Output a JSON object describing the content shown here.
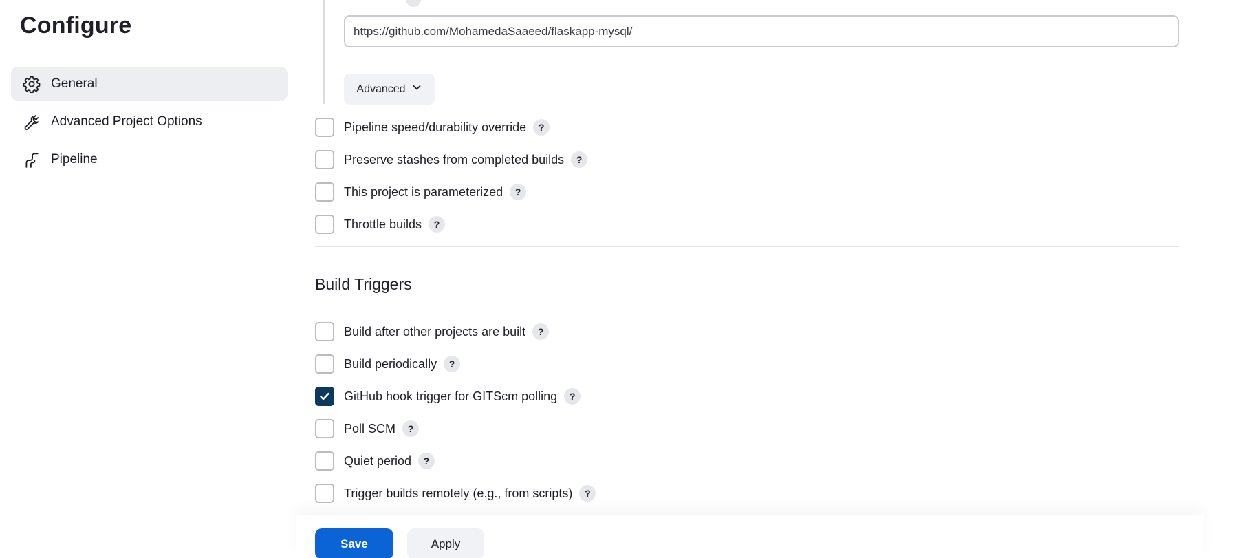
{
  "sidebar": {
    "title": "Configure",
    "items": [
      {
        "label": "General",
        "icon": "gear-icon",
        "active": true
      },
      {
        "label": "Advanced Project Options",
        "icon": "wrench-icon",
        "active": false
      },
      {
        "label": "Pipeline",
        "icon": "pipeline-icon",
        "active": false
      }
    ]
  },
  "scm": {
    "url_value": "https://github.com/MohamedaSaaeed/flaskapp-mysql/",
    "advanced_label": "Advanced"
  },
  "general_options": [
    {
      "label": "Pipeline speed/durability override",
      "checked": false
    },
    {
      "label": "Preserve stashes from completed builds",
      "checked": false
    },
    {
      "label": "This project is parameterized",
      "checked": false
    },
    {
      "label": "Throttle builds",
      "checked": false
    }
  ],
  "build_triggers": {
    "title": "Build Triggers",
    "options": [
      {
        "label": "Build after other projects are built",
        "checked": false
      },
      {
        "label": "Build periodically",
        "checked": false
      },
      {
        "label": "GitHub hook trigger for GITScm polling",
        "checked": true
      },
      {
        "label": "Poll SCM",
        "checked": false
      },
      {
        "label": "Quiet period",
        "checked": false
      },
      {
        "label": "Trigger builds remotely (e.g., from scripts)",
        "checked": false
      }
    ]
  },
  "help_glyph": "?",
  "footer": {
    "save_label": "Save",
    "apply_label": "Apply"
  },
  "colors": {
    "primary": "#0b64d6",
    "checkbox_checked": "#0b3a5e",
    "nav_active_bg": "#edeef2"
  }
}
